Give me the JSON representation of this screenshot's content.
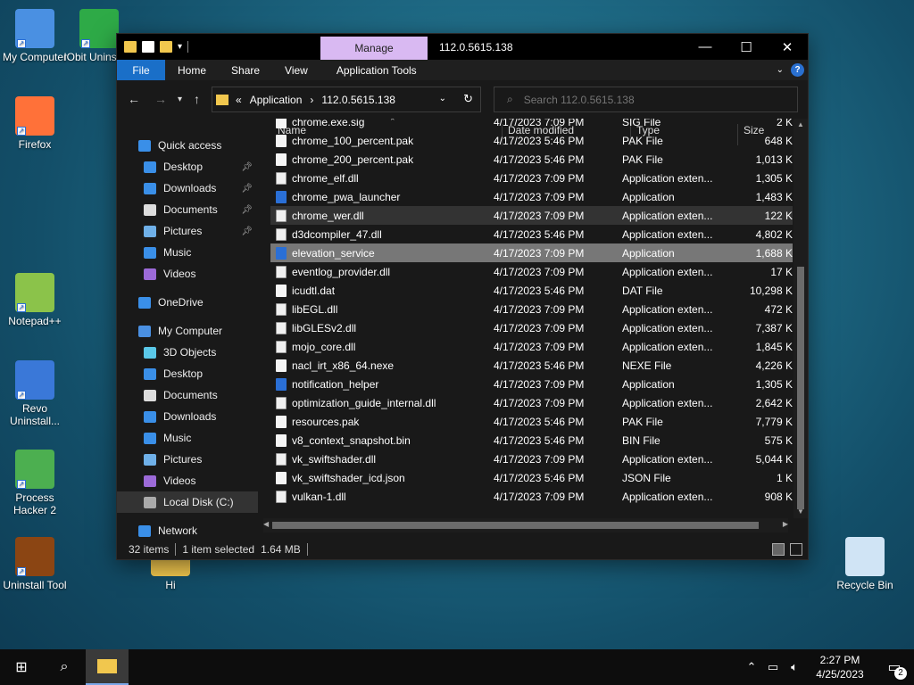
{
  "desktop_icons": [
    {
      "label": "My Computer",
      "color": "#4a90e2"
    },
    {
      "label": "IObit Uninsta...",
      "color": "#2eaa47"
    },
    {
      "label": "Firefox",
      "color": "#ff7139"
    },
    {
      "label": "Notepad++",
      "color": "#8bc34a"
    },
    {
      "label": "Revo Uninstall...",
      "color": "#3a78d8"
    },
    {
      "label": "Process Hacker 2",
      "color": "#4caf50"
    },
    {
      "label": "Uninstall Tool",
      "color": "#8b4513"
    },
    {
      "label": "Hi",
      "color": "#f1c74e"
    },
    {
      "label": "Recycle Bin",
      "color": "#d0e4f5"
    }
  ],
  "window": {
    "title": "112.0.5615.138",
    "manage_tab": "Manage",
    "ribbon_tabs": [
      "File",
      "Home",
      "Share",
      "View",
      "Application Tools"
    ],
    "address": {
      "prefix": "«",
      "crumb1": "Application",
      "sep": "›",
      "crumb2": "112.0.5615.138"
    },
    "search_placeholder": "Search 112.0.5615.138",
    "columns": {
      "name": "Name",
      "date": "Date modified",
      "type": "Type",
      "size": "Size"
    },
    "nav": [
      {
        "label": "Quick access",
        "icon": "star-icon",
        "color": "#3a8fe8",
        "indent": 0,
        "pin": false
      },
      {
        "label": "Desktop",
        "icon": "desktop-icon",
        "color": "#3a8fe8",
        "indent": 1,
        "pin": true
      },
      {
        "label": "Downloads",
        "icon": "download-icon",
        "color": "#3a8fe8",
        "indent": 1,
        "pin": true
      },
      {
        "label": "Documents",
        "icon": "document-icon",
        "color": "#dddddd",
        "indent": 1,
        "pin": true
      },
      {
        "label": "Pictures",
        "icon": "picture-icon",
        "color": "#6fb0e8",
        "indent": 1,
        "pin": true
      },
      {
        "label": "Music",
        "icon": "music-icon",
        "color": "#3a8fe8",
        "indent": 1,
        "pin": false
      },
      {
        "label": "Videos",
        "icon": "video-icon",
        "color": "#9c6ad8",
        "indent": 1,
        "pin": false
      },
      {
        "label": "OneDrive",
        "icon": "cloud-icon",
        "color": "#3a8fe8",
        "indent": 0,
        "pin": false,
        "gap": true
      },
      {
        "label": "My Computer",
        "icon": "computer-icon",
        "color": "#4a90e2",
        "indent": 0,
        "pin": false,
        "gap": true
      },
      {
        "label": "3D Objects",
        "icon": "cube-icon",
        "color": "#5ac8e8",
        "indent": 1,
        "pin": false
      },
      {
        "label": "Desktop",
        "icon": "desktop-icon",
        "color": "#3a8fe8",
        "indent": 1,
        "pin": false
      },
      {
        "label": "Documents",
        "icon": "document-icon",
        "color": "#dddddd",
        "indent": 1,
        "pin": false
      },
      {
        "label": "Downloads",
        "icon": "download-icon",
        "color": "#3a8fe8",
        "indent": 1,
        "pin": false
      },
      {
        "label": "Music",
        "icon": "music-icon",
        "color": "#3a8fe8",
        "indent": 1,
        "pin": false
      },
      {
        "label": "Pictures",
        "icon": "picture-icon",
        "color": "#6fb0e8",
        "indent": 1,
        "pin": false
      },
      {
        "label": "Videos",
        "icon": "video-icon",
        "color": "#9c6ad8",
        "indent": 1,
        "pin": false
      },
      {
        "label": "Local Disk (C:)",
        "icon": "drive-icon",
        "color": "#aaaaaa",
        "indent": 1,
        "pin": false,
        "selected": true
      },
      {
        "label": "Network",
        "icon": "network-icon",
        "color": "#3a8fe8",
        "indent": 0,
        "pin": false,
        "gap": true
      }
    ],
    "files": [
      {
        "name": "chrome.exe.sig",
        "date": "4/17/2023 7:09 PM",
        "type": "SIG File",
        "size": "2 K",
        "kind": "file"
      },
      {
        "name": "chrome_100_percent.pak",
        "date": "4/17/2023 5:46 PM",
        "type": "PAK File",
        "size": "648 K",
        "kind": "file"
      },
      {
        "name": "chrome_200_percent.pak",
        "date": "4/17/2023 5:46 PM",
        "type": "PAK File",
        "size": "1,013 K",
        "kind": "file"
      },
      {
        "name": "chrome_elf.dll",
        "date": "4/17/2023 7:09 PM",
        "type": "Application exten...",
        "size": "1,305 K",
        "kind": "dll"
      },
      {
        "name": "chrome_pwa_launcher",
        "date": "4/17/2023 7:09 PM",
        "type": "Application",
        "size": "1,483 K",
        "kind": "app"
      },
      {
        "name": "chrome_wer.dll",
        "date": "4/17/2023 7:09 PM",
        "type": "Application exten...",
        "size": "122 K",
        "kind": "dll",
        "state": "hover"
      },
      {
        "name": "d3dcompiler_47.dll",
        "date": "4/17/2023 5:46 PM",
        "type": "Application exten...",
        "size": "4,802 K",
        "kind": "dll"
      },
      {
        "name": "elevation_service",
        "date": "4/17/2023 7:09 PM",
        "type": "Application",
        "size": "1,688 K",
        "kind": "app",
        "state": "selected"
      },
      {
        "name": "eventlog_provider.dll",
        "date": "4/17/2023 7:09 PM",
        "type": "Application exten...",
        "size": "17 K",
        "kind": "dll"
      },
      {
        "name": "icudtl.dat",
        "date": "4/17/2023 5:46 PM",
        "type": "DAT File",
        "size": "10,298 K",
        "kind": "file"
      },
      {
        "name": "libEGL.dll",
        "date": "4/17/2023 7:09 PM",
        "type": "Application exten...",
        "size": "472 K",
        "kind": "dll"
      },
      {
        "name": "libGLESv2.dll",
        "date": "4/17/2023 7:09 PM",
        "type": "Application exten...",
        "size": "7,387 K",
        "kind": "dll"
      },
      {
        "name": "mojo_core.dll",
        "date": "4/17/2023 7:09 PM",
        "type": "Application exten...",
        "size": "1,845 K",
        "kind": "dll"
      },
      {
        "name": "nacl_irt_x86_64.nexe",
        "date": "4/17/2023 5:46 PM",
        "type": "NEXE File",
        "size": "4,226 K",
        "kind": "file"
      },
      {
        "name": "notification_helper",
        "date": "4/17/2023 7:09 PM",
        "type": "Application",
        "size": "1,305 K",
        "kind": "app"
      },
      {
        "name": "optimization_guide_internal.dll",
        "date": "4/17/2023 7:09 PM",
        "type": "Application exten...",
        "size": "2,642 K",
        "kind": "dll"
      },
      {
        "name": "resources.pak",
        "date": "4/17/2023 5:46 PM",
        "type": "PAK File",
        "size": "7,779 K",
        "kind": "file"
      },
      {
        "name": "v8_context_snapshot.bin",
        "date": "4/17/2023 5:46 PM",
        "type": "BIN File",
        "size": "575 K",
        "kind": "file"
      },
      {
        "name": "vk_swiftshader.dll",
        "date": "4/17/2023 7:09 PM",
        "type": "Application exten...",
        "size": "5,044 K",
        "kind": "dll"
      },
      {
        "name": "vk_swiftshader_icd.json",
        "date": "4/17/2023 5:46 PM",
        "type": "JSON File",
        "size": "1 K",
        "kind": "file"
      },
      {
        "name": "vulkan-1.dll",
        "date": "4/17/2023 7:09 PM",
        "type": "Application exten...",
        "size": "908 K",
        "kind": "dll"
      }
    ],
    "status": {
      "items": "32 items",
      "selected": "1 item selected",
      "size": "1.64 MB"
    }
  },
  "taskbar": {
    "time": "2:27 PM",
    "date": "4/25/2023",
    "notifications": "2"
  }
}
